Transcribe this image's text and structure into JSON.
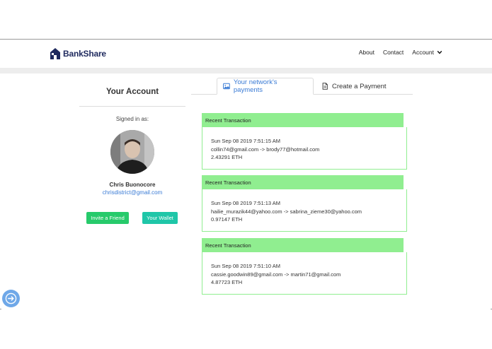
{
  "nav": {
    "brand": "BankShare",
    "about": "About",
    "contact": "Contact",
    "account": "Account"
  },
  "account": {
    "title": "Your Account",
    "signed_in_label": "Signed in as:",
    "name": "Chris Buonocore",
    "email": "chrisdistrict@gmail.com",
    "invite_label": "Invite a Friend",
    "wallet_label": "Your Wallet"
  },
  "tabs": {
    "network": "Your network's payments",
    "create": "Create a Payment"
  },
  "transactions": [
    {
      "header": "Recent Transaction",
      "date": "Sun Sep 08 2019 7:51:15 AM",
      "parties": "collin74@gmail.com -> brody77@hotmail.com",
      "amount": "2.43291 ETH"
    },
    {
      "header": "Recent Transaction",
      "date": "Sun Sep 08 2019 7:51:13 AM",
      "parties": "hailie_murazik44@yahoo.com -> sabrina_zieme30@yahoo.com",
      "amount": "0.97147 ETH"
    },
    {
      "header": "Recent Transaction",
      "date": "Sun Sep 08 2019 7:51:10 AM",
      "parties": "cassie.goodwin89@gmail.com -> martin71@gmail.com",
      "amount": "4.87723 ETH"
    }
  ],
  "colors": {
    "accent_blue": "#3a7bd5",
    "brand_navy": "#1f2a5e",
    "tx_green": "#90ee90",
    "invite_green": "#27ca6b",
    "wallet_teal": "#1fc6a8"
  },
  "icons": {
    "brand": "house-logo-icon",
    "account_menu": "chevron-down-icon",
    "network_tab": "image-icon",
    "create_tab": "document-icon",
    "floating_action": "arrow-right-circle-icon"
  }
}
